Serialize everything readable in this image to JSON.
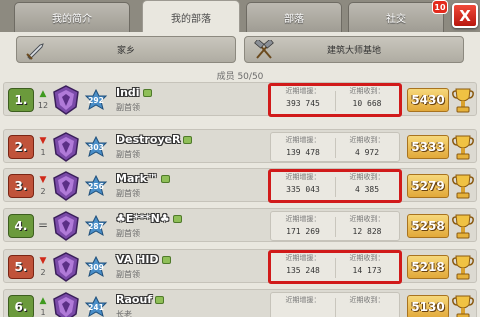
{
  "tabs": [
    {
      "label": "我的简介",
      "active": false
    },
    {
      "label": "我的部落",
      "active": true
    },
    {
      "label": "部落",
      "active": false
    },
    {
      "label": "社交",
      "active": false
    }
  ],
  "notification_count": "10",
  "close_label": "X",
  "sub_buttons": [
    {
      "label": "家乡",
      "icon": "sword-icon"
    },
    {
      "label": "建筑大师基地",
      "icon": "hammers-icon"
    }
  ],
  "members_count": "成员 50/50",
  "stat_labels": {
    "donated": "近期增援：",
    "received": "近期收到："
  },
  "members": [
    {
      "rank": "1.",
      "trend": "up",
      "trend_value": "12",
      "level": "292",
      "name": "Indi",
      "role": "副首领",
      "donated": "393 745",
      "received": "10 668",
      "trophies": "5430",
      "highlighted": true
    },
    {
      "rank": "2.",
      "trend": "down",
      "trend_value": "1",
      "level": "303",
      "name": "DestroyeR",
      "role": "副首领",
      "donated": "139 478",
      "received": "4 972",
      "trophies": "5333",
      "highlighted": false
    },
    {
      "rank": "3.",
      "trend": "down",
      "trend_value": "2",
      "level": "256",
      "name": "Mark™",
      "role": "副首领",
      "donated": "335 043",
      "received": "4 385",
      "trophies": "5279",
      "highlighted": true
    },
    {
      "rank": "4.",
      "trend": "same",
      "trend_value": "=",
      "level": "287",
      "name": "♣E***N♣",
      "role": "副首领",
      "donated": "171 269",
      "received": "12 828",
      "trophies": "5258",
      "highlighted": false
    },
    {
      "rank": "5.",
      "trend": "down",
      "trend_value": "2",
      "level": "309",
      "name": "VA HID",
      "role": "副首领",
      "donated": "135 248",
      "received": "14 173",
      "trophies": "5218",
      "highlighted": true
    },
    {
      "rank": "6.",
      "trend": "up",
      "trend_value": "1",
      "level": "241",
      "name": "Raouf",
      "role": "长老",
      "donated": "",
      "received": "",
      "trophies": "5130",
      "highlighted": false
    }
  ],
  "colors": {
    "highlight": "#d11a1a",
    "rank_up": "#6b9a3c",
    "rank_down": "#c0533a",
    "trophy": "#e2a93a"
  }
}
